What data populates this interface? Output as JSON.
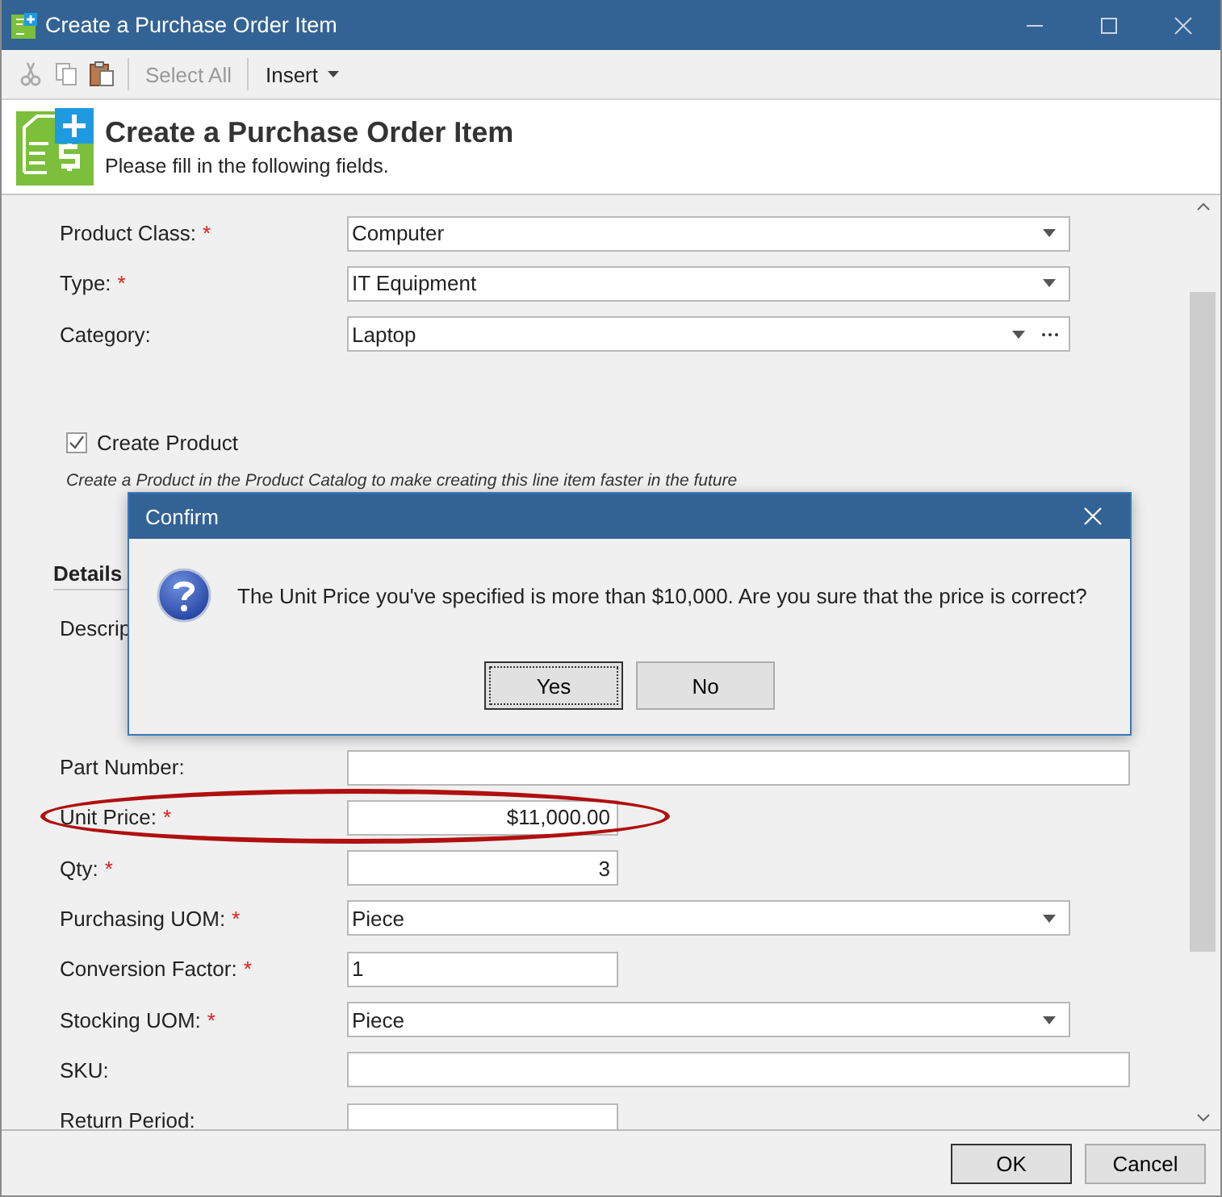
{
  "window": {
    "title": "Create a Purchase Order Item"
  },
  "toolbar": [
    {
      "kind": "scissors",
      "disabled": true
    },
    {
      "kind": "copy",
      "disabled": true
    },
    {
      "kind": "paste",
      "disabled": false
    },
    {
      "kind": "text",
      "label": "Select All",
      "disabled": true
    },
    {
      "kind": "menu",
      "label": "Insert",
      "disabled": false
    }
  ],
  "header": {
    "title": "Create a Purchase Order Item",
    "subtitle": "Please fill in the following fields."
  },
  "top_fields": [
    {
      "label": "Product Class:",
      "marker": "*",
      "kind": "dropdown",
      "value": "Computer",
      "highlighted": false
    },
    {
      "label": "Type:",
      "marker": "*",
      "kind": "dropdown",
      "value": "IT Equipment",
      "highlighted": false
    },
    {
      "label": "Category:",
      "kind": "lookup",
      "value": "Laptop",
      "highlighted": false
    }
  ],
  "create_product": {
    "label": "Create Product",
    "checked": true,
    "hint": "Create a Product in the Product Catalog to make creating this line item faster in the future"
  },
  "section": {
    "title": "Details"
  },
  "detail_fields": [
    {
      "label": "Descrip",
      "kind": "covered",
      "highlighted": false
    },
    {
      "label": "Part Number:",
      "kind": "text",
      "highlighted": false
    },
    {
      "label": "Unit Price:",
      "marker": "*",
      "kind": "amount",
      "value": "$11,000.00",
      "highlighted": true
    },
    {
      "label": "Qty:",
      "marker": "*",
      "kind": "amount",
      "value": "3",
      "highlighted": false
    },
    {
      "label": "Purchasing UOM:",
      "marker": "*",
      "kind": "dropdown",
      "value": "Piece",
      "highlighted": false
    },
    {
      "label": "Conversion Factor:",
      "marker": "*",
      "kind": "short",
      "value": "1",
      "highlighted": false
    },
    {
      "label": "Stocking UOM:",
      "marker": "*",
      "kind": "dropdown",
      "value": "Piece",
      "highlighted": false
    },
    {
      "label": "SKU:",
      "kind": "text",
      "highlighted": false
    },
    {
      "label": "Return Period:",
      "kind": "short",
      "highlighted": false
    }
  ],
  "footer": {
    "buttons": [
      {
        "label": "OK",
        "default": true
      },
      {
        "label": "Cancel",
        "default": false
      }
    ]
  },
  "dialog": {
    "title": "Confirm",
    "message": "The Unit Price you've specified is more than $10,000. Are you sure that the price is correct?",
    "buttons": [
      {
        "label": "Yes",
        "default": true
      },
      {
        "label": "No",
        "default": false
      }
    ]
  }
}
